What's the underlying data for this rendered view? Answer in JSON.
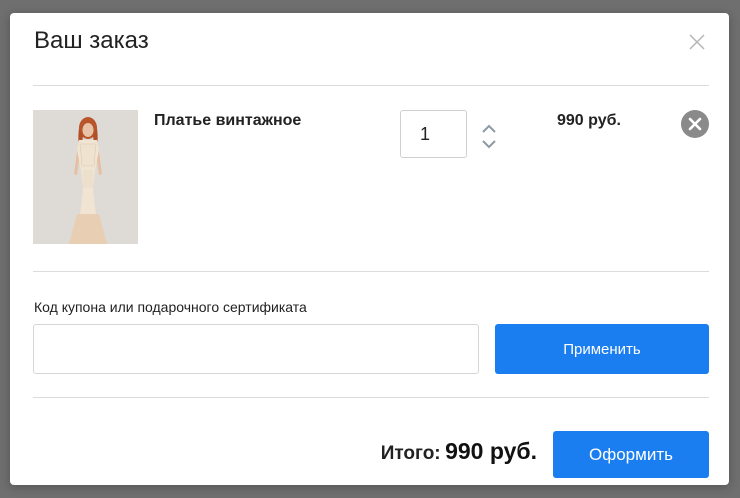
{
  "modal": {
    "title": "Ваш заказ"
  },
  "cart": {
    "items": [
      {
        "name": "Платье винтажное",
        "quantity": "1",
        "price": "990 руб."
      }
    ]
  },
  "coupon": {
    "label": "Код купона или подарочного сертификата",
    "value": "",
    "apply_label": "Применить"
  },
  "summary": {
    "total_label": "Итого:",
    "total_value": "990 руб.",
    "checkout_label": "Оформить"
  },
  "colors": {
    "accent": "#1a7ef0",
    "overlay": "#6f6f6f",
    "remove": "#8a8a8a"
  },
  "icons": {
    "close": "close-icon",
    "remove": "remove-item-icon",
    "increment": "chevron-up-icon",
    "decrement": "chevron-down-icon"
  }
}
